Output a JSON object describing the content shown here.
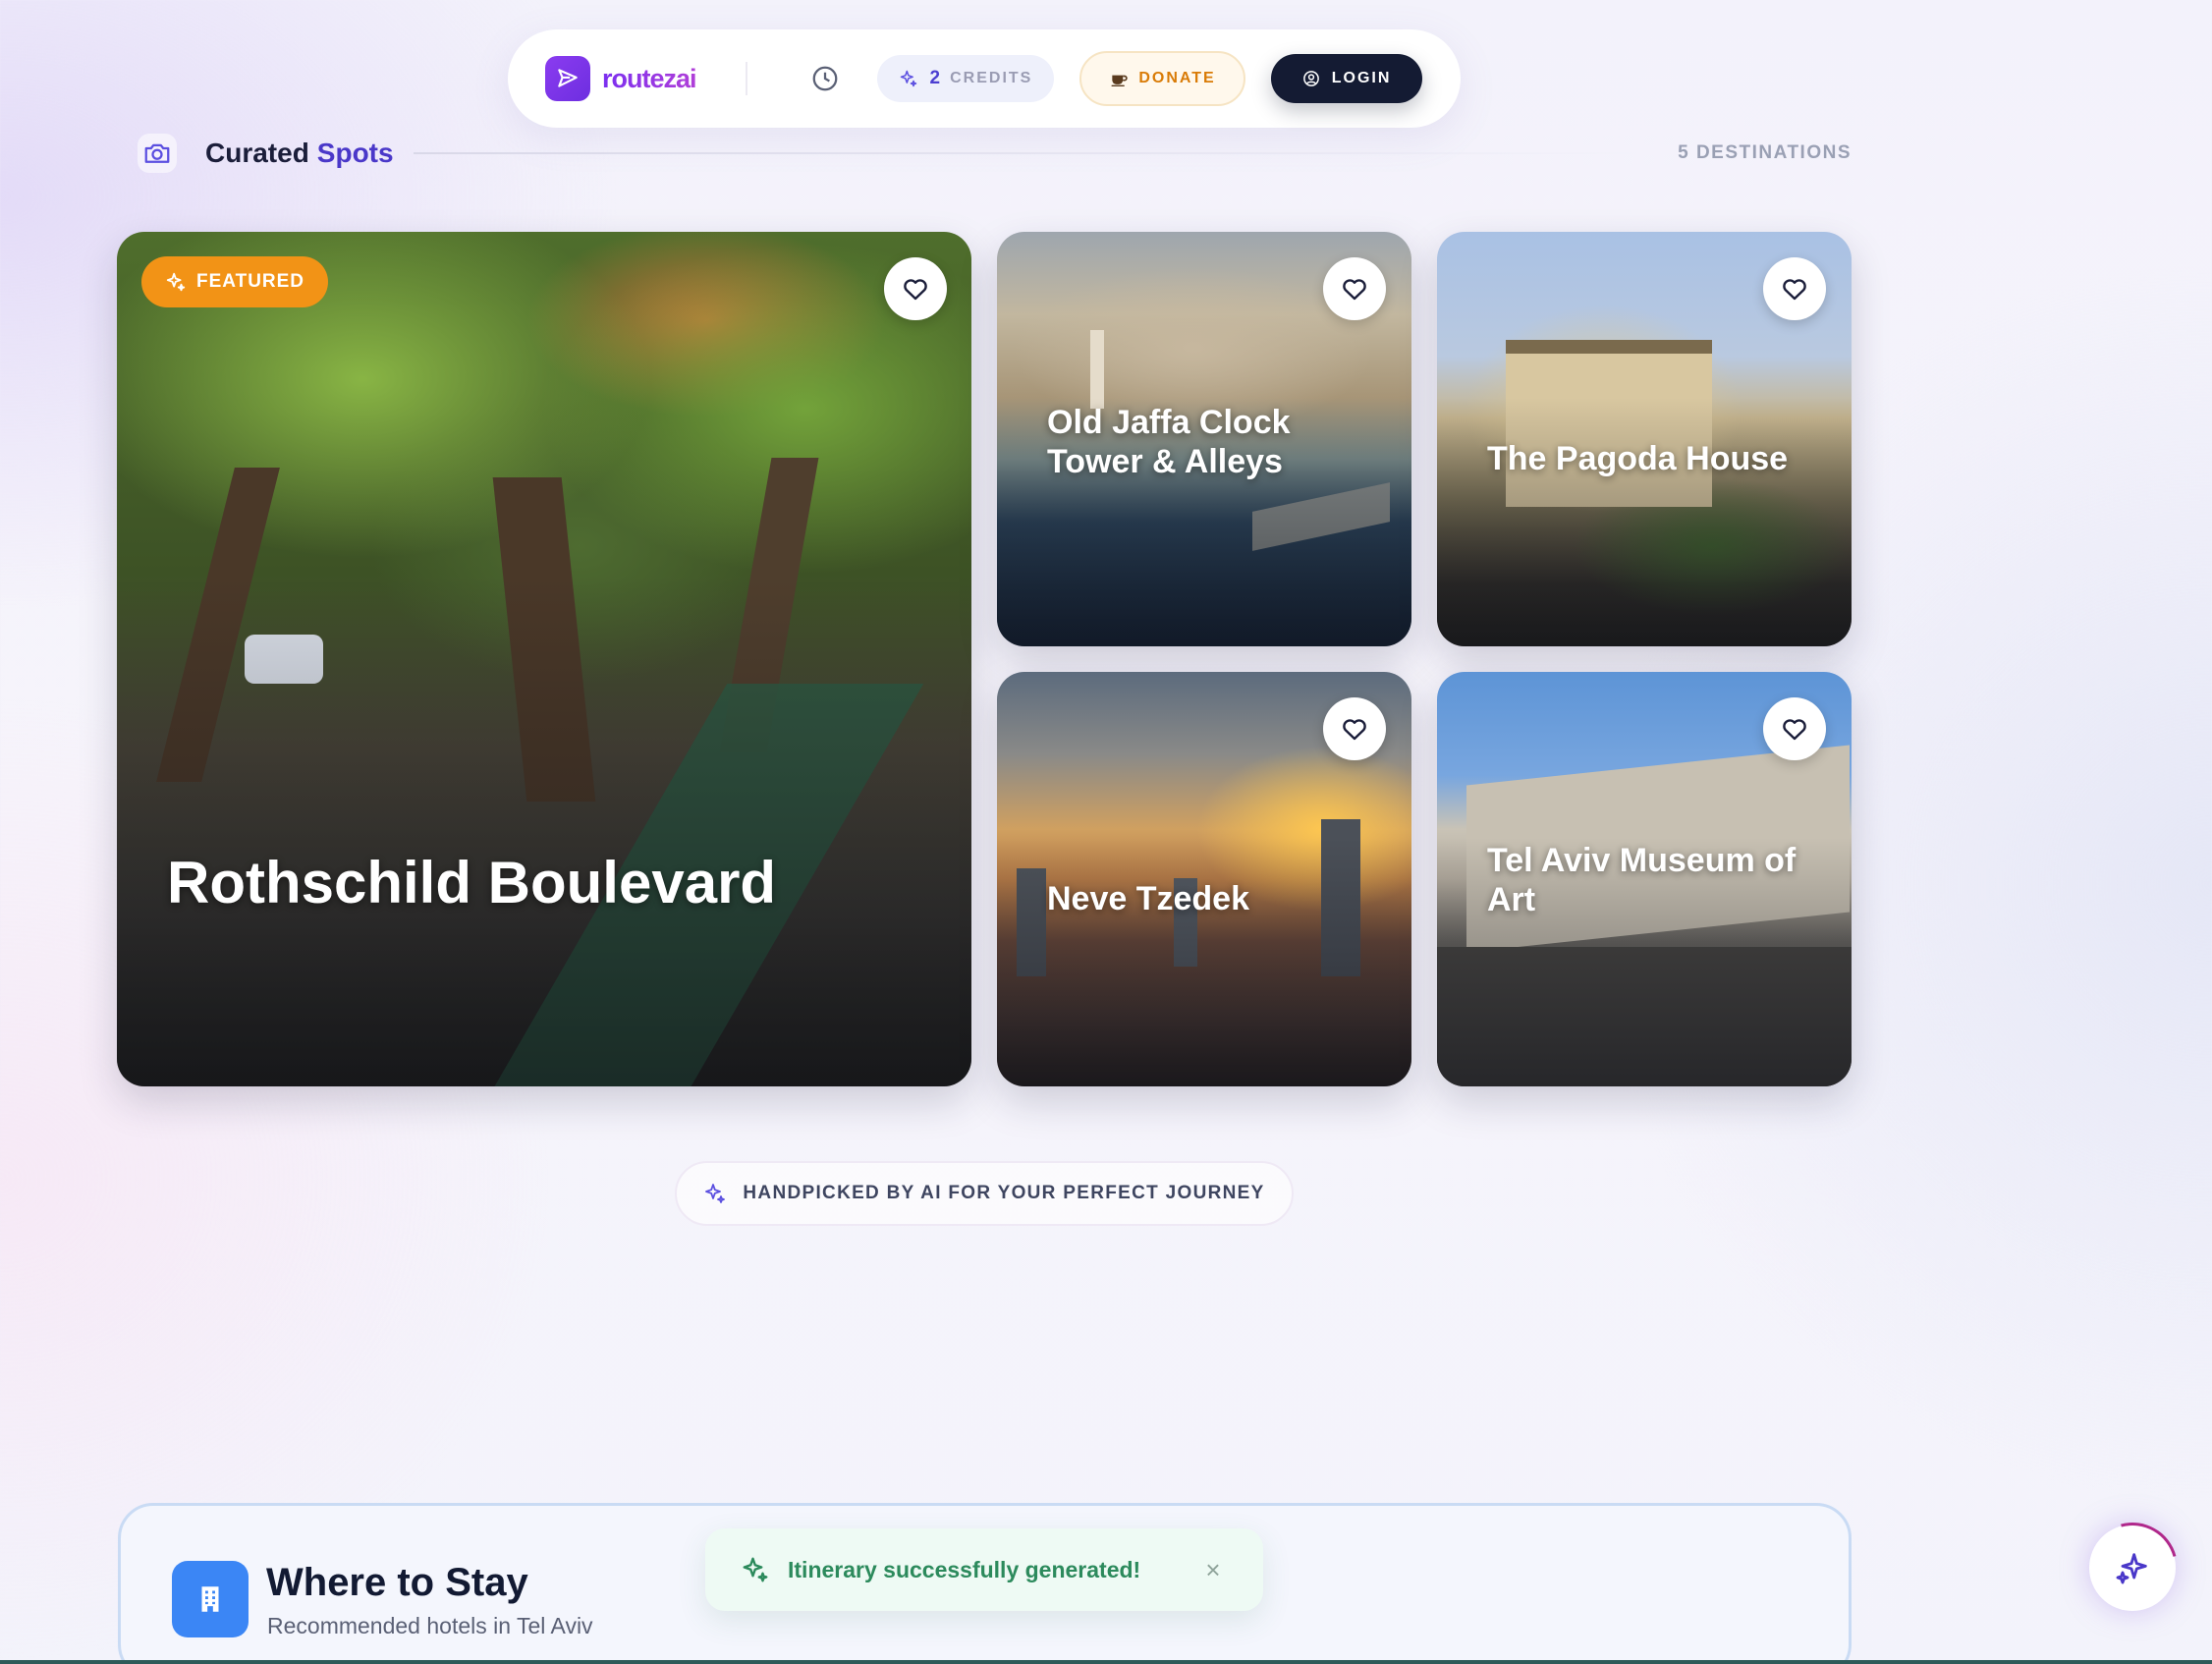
{
  "navbar": {
    "logo_text": "routezai",
    "credits_count": "2",
    "credits_label": "CREDITS",
    "donate_label": "DONATE",
    "login_label": "LOGIN"
  },
  "section": {
    "title": "Curated",
    "title_accent": "Spots",
    "count_label": "5 DESTINATIONS"
  },
  "spots": [
    {
      "title": "Rothschild Boulevard",
      "badge": "FEATURED"
    },
    {
      "title": "Old Jaffa Clock Tower & Alleys"
    },
    {
      "title": "The Pagoda House"
    },
    {
      "title": "Neve Tzedek"
    },
    {
      "title": "Tel Aviv Museum of Art"
    }
  ],
  "ai_pill": {
    "label": "HANDPICKED BY AI FOR YOUR PERFECT JOURNEY"
  },
  "stay": {
    "title": "Where to Stay",
    "subtitle": "Recommended hotels in Tel Aviv"
  },
  "toast": {
    "message": "Itinerary successfully generated!",
    "close": "×"
  },
  "colors": {
    "brand": "#7b2ff0",
    "accent": "#4a38c9",
    "featured": "#f29316",
    "success": "#2c8a5c",
    "login_bg": "#141b33",
    "stay_icon": "#3b86f5"
  },
  "icons": [
    "send-icon",
    "clock-icon",
    "sparkle-icon",
    "coffee-icon",
    "user-circle-icon",
    "camera-icon",
    "heart-icon",
    "building-icon",
    "close-icon"
  ]
}
